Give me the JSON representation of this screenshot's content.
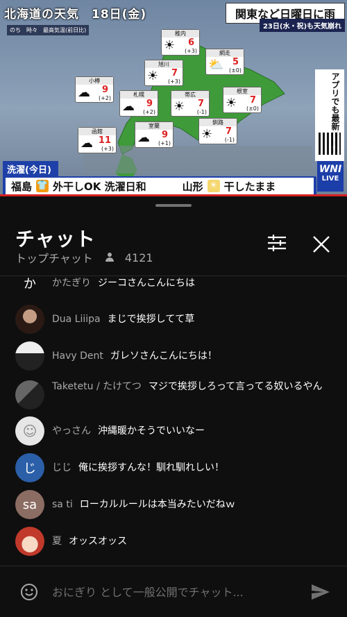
{
  "video": {
    "title": "北海道の天気　18日(金)",
    "legend": [
      "のち",
      "時々",
      "最高気温(前日比)"
    ],
    "headline": "関東など日曜日に雨",
    "subline": "23日(水・祝)も天気崩れ",
    "app_promo": "アプリでも最新情報を",
    "logo": {
      "big": "WNI",
      "small": "LIVE"
    },
    "cities": [
      {
        "name": "稚内",
        "weather": "☀",
        "high": "6",
        "diff": "(+3)"
      },
      {
        "name": "網走",
        "weather": "⛅",
        "high": "5",
        "diff": "(±0)"
      },
      {
        "name": "旭川",
        "weather": "☀",
        "high": "7",
        "diff": "(+3)"
      },
      {
        "name": "小樽",
        "weather": "☁",
        "high": "9",
        "diff": "(+2)"
      },
      {
        "name": "札幌",
        "weather": "☁",
        "high": "9",
        "diff": "(+2)"
      },
      {
        "name": "帯広",
        "weather": "☀",
        "high": "7",
        "diff": "(-1)"
      },
      {
        "name": "根室",
        "weather": "☀",
        "high": "7",
        "diff": "(±0)"
      },
      {
        "name": "函館",
        "weather": "☁",
        "high": "11",
        "diff": "(+3)"
      },
      {
        "name": "室蘭",
        "weather": "☁",
        "high": "9",
        "diff": "(+1)"
      },
      {
        "name": "釧路",
        "weather": "☀",
        "high": "7",
        "diff": "(-1)"
      }
    ],
    "laundry": {
      "tag": "洗濯(今日)",
      "items": [
        {
          "place": "福島",
          "status": "外干しOK 洗濯日和"
        },
        {
          "place": "山形",
          "status": "干したまま"
        }
      ]
    }
  },
  "chat": {
    "title": "チャット",
    "mode": "トップチャット",
    "viewer_count": "4121",
    "input_placeholder": "おにぎり として一般公開でチャット...",
    "messages": [
      {
        "avatar_text": "か",
        "avatar_color": "#1f7a8c",
        "author": "かたぎり",
        "text": "ジーコさんこんにちは"
      },
      {
        "avatar_text": "",
        "avatar_color": "#7a5a4a",
        "author": "Dua Liiipa",
        "text": "まじで挨拶してて草"
      },
      {
        "avatar_text": "",
        "avatar_color": "#e8e8e8",
        "author": "Havy Dent",
        "text": "ガレソさんこんにちは！"
      },
      {
        "avatar_text": "",
        "avatar_color": "#555555",
        "author": "Taketetu / たけてつ",
        "text": "マジで挨拶しろって言ってる奴いるやん"
      },
      {
        "avatar_text": "",
        "avatar_color": "#dcdcdc",
        "author": "やっさん",
        "text": "沖縄暖かそうでいいなー"
      },
      {
        "avatar_text": "じ",
        "avatar_color": "#2b5fa8",
        "author": "じじ",
        "text": "俺に挨拶すんな！馴れ馴れしい！"
      },
      {
        "avatar_text": "sa",
        "avatar_color": "#8c6d63",
        "author": "sa ti",
        "text": "ローカルルールは本当みたいだねｗ"
      },
      {
        "avatar_text": "",
        "avatar_color": "#d9534f",
        "author": "夏",
        "text": "オッスオッス"
      }
    ]
  },
  "colors": {
    "background": "#0f0f0f",
    "secondary_text": "#aaaaaa",
    "accent_red": "#d62020"
  }
}
